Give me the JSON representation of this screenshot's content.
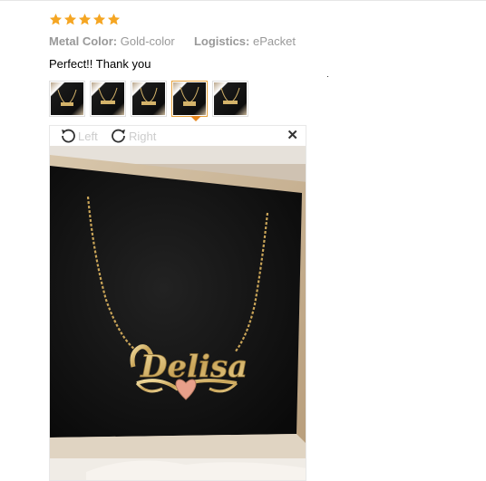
{
  "review": {
    "rating": 5,
    "rating_max": 5,
    "star_color": "#f5a623",
    "meta": {
      "color_label": "Metal Color:",
      "color_value": "Gold-color",
      "logistics_label": "Logistics:",
      "logistics_value": "ePacket"
    },
    "comment": "Perfect!! Thank you",
    "thumbnails": [
      {
        "name": "review-photo-1",
        "active": false
      },
      {
        "name": "review-photo-2",
        "active": false
      },
      {
        "name": "review-photo-3",
        "active": false
      },
      {
        "name": "review-photo-4",
        "active": true
      },
      {
        "name": "review-photo-5",
        "active": false
      }
    ],
    "active_accent": "#e6861e"
  },
  "viewer": {
    "rotate_left_label": "Left",
    "rotate_right_label": "Right",
    "close_icon": "close-icon",
    "photo_text": "Delisa"
  }
}
